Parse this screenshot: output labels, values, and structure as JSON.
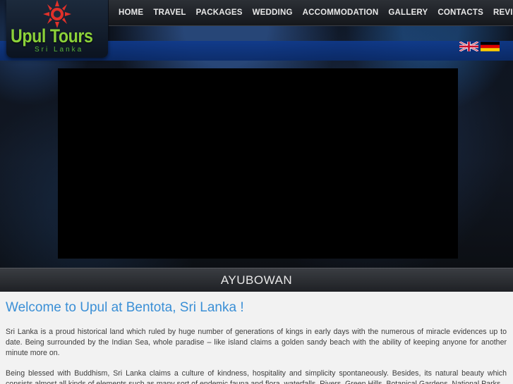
{
  "logo": {
    "brand_name": "Upul Tours",
    "subtitle": "Sri Lanka"
  },
  "nav": {
    "items": [
      "HOME",
      "TRAVEL",
      "PACKAGES",
      "WEDDING",
      "ACCOMMODATION",
      "GALLERY",
      "CONTACTS",
      "REVIEWS"
    ]
  },
  "languages": [
    "english-flag",
    "german-flag"
  ],
  "banner": {
    "title": "AYUBOWAN"
  },
  "content": {
    "heading": "Welcome to Upul at Bentota, Sri Lanka !",
    "paragraph_1": "Sri Lanka is a proud historical land which ruled by huge number of generations of kings in early days with the numerous of miracle evidences up to date. Being surrounded by the Indian Sea, whole paradise – like island claims a golden sandy beach with the ability of keeping anyone for another minute more on.",
    "paragraph_2": "Being blessed with Buddhism, Sri Lanka claims a culture of kindness, hospitality and simplicity spontaneously. Besides, its natural beauty which consists almost all kinds of elements such as many sort of endemic fauna and flora, waterfalls, Rivers, Green Hills, Botanical Gardens, National Parks"
  },
  "colors": {
    "heading": "#3a8fd6",
    "logo_green": "#8bd13a",
    "nav_bg": "#1e2125"
  }
}
